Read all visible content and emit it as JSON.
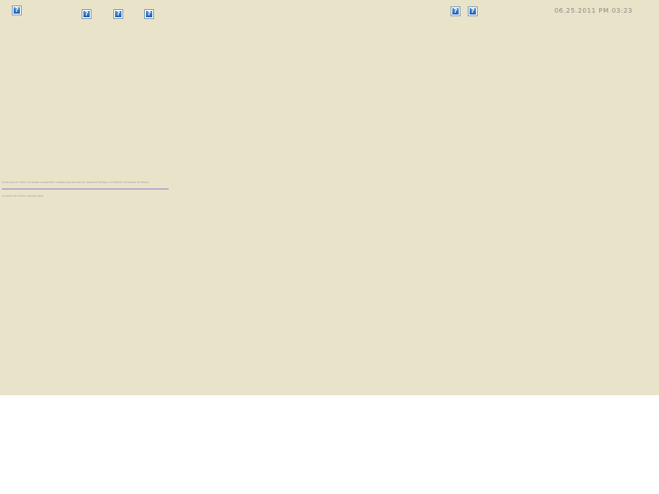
{
  "header": {
    "timestamp": "06.25.2011 PM 03:23",
    "left_images": [
      {
        "icon": "broken-image-icon",
        "glyph": "?"
      },
      {
        "icon": "broken-image-icon",
        "glyph": "?"
      },
      {
        "icon": "broken-image-icon",
        "glyph": "?"
      },
      {
        "icon": "broken-image-icon",
        "glyph": "?"
      }
    ],
    "right_images": [
      {
        "icon": "broken-image-icon",
        "glyph": "?"
      },
      {
        "icon": "broken-image-icon",
        "glyph": "?"
      }
    ]
  },
  "content": {
    "caption": "lorem ipsum dolor sit amet consectetur adipiscing elit sed do eiusmod tempor incididunt ut labore et dolore",
    "footnote": "ut enim ad minim veniam quis"
  },
  "colors": {
    "page_background": "#e9e3c9",
    "divider": "#8f8fd0",
    "muted_text": "#8a8a86"
  }
}
